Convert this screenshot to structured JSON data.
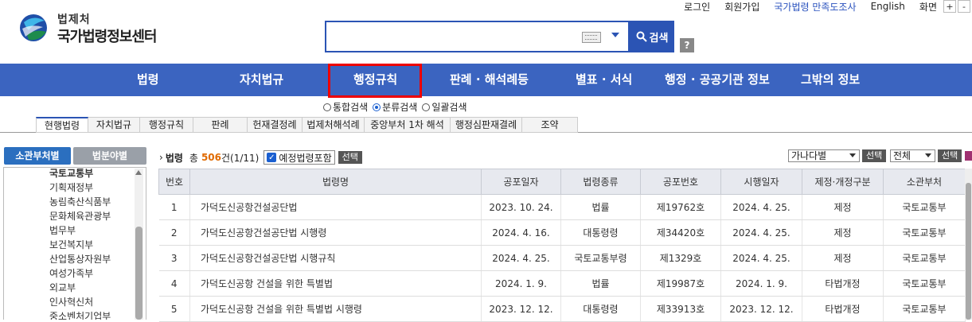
{
  "util": {
    "login": "로그인",
    "signup": "회원가입",
    "survey": "국가법령 만족도조사",
    "english": "English",
    "screen": "화면",
    "zoom_in": "+",
    "zoom_out": "-"
  },
  "logo": {
    "line1": "법제처",
    "line2": "국가법령정보센터"
  },
  "search": {
    "value": "",
    "button": "검색",
    "help": "?"
  },
  "nav": [
    {
      "label": "법령"
    },
    {
      "label": "자치법규"
    },
    {
      "label": "행정규칙"
    },
    {
      "label": "판례 · 해석례등"
    },
    {
      "label": "별표 · 서식"
    },
    {
      "label": "행정 · 공공기관 정보"
    },
    {
      "label": "그밖의 정보"
    }
  ],
  "search_modes": [
    {
      "label": "통합검색",
      "checked": false
    },
    {
      "label": "분류검색",
      "checked": true
    },
    {
      "label": "일괄검색",
      "checked": false
    }
  ],
  "tabs": [
    {
      "label": "현행법령"
    },
    {
      "label": "자치법규"
    },
    {
      "label": "행정규칙"
    },
    {
      "label": "판례"
    },
    {
      "label": "헌재결정례"
    },
    {
      "label": "법제처해석례"
    },
    {
      "label": "중앙부처 1차 해석"
    },
    {
      "label": "행정심판재결례"
    },
    {
      "label": "조약"
    }
  ],
  "side": {
    "tab_ministry": "소관부처별",
    "tab_field": "법분야별",
    "items": [
      "국토교통부",
      "기획재정부",
      "농림축산식품부",
      "문화체육관광부",
      "법무부",
      "보건복지부",
      "산업통상자원부",
      "여성가족부",
      "외교부",
      "인사혁신처",
      "중소벤처기업부"
    ]
  },
  "results": {
    "title": "법령",
    "total_label": "총",
    "count": "506",
    "count_suffix": "건(1/11)",
    "include_scheduled": "예정법령포함",
    "select": "선택",
    "sort_option": "가나다별",
    "scope_option": "전체"
  },
  "table": {
    "headers": [
      "번호",
      "법령명",
      "공포일자",
      "법령종류",
      "공포번호",
      "시행일자",
      "제정·개정구분",
      "소관부처"
    ],
    "rows": [
      [
        "1",
        "가덕도신공항건설공단법",
        "2023. 10. 24.",
        "법률",
        "제19762호",
        "2024. 4. 25.",
        "제정",
        "국토교통부"
      ],
      [
        "2",
        "가덕도신공항건설공단법 시행령",
        "2024. 4. 16.",
        "대통령령",
        "제34420호",
        "2024. 4. 25.",
        "제정",
        "국토교통부"
      ],
      [
        "3",
        "가덕도신공항건설공단법 시행규칙",
        "2024. 4. 25.",
        "국토교통부령",
        "제1329호",
        "2024. 4. 25.",
        "제정",
        "국토교통부"
      ],
      [
        "4",
        "가덕도신공항 건설을 위한 특별법",
        "2024. 1. 9.",
        "법률",
        "제19987호",
        "2024. 1. 9.",
        "타법개정",
        "국토교통부"
      ],
      [
        "5",
        "가덕도신공항 건설을 위한 특별법 시행령",
        "2023. 12. 12.",
        "대통령령",
        "제33913호",
        "2023. 12. 12.",
        "타법개정",
        "국토교통부"
      ]
    ]
  }
}
